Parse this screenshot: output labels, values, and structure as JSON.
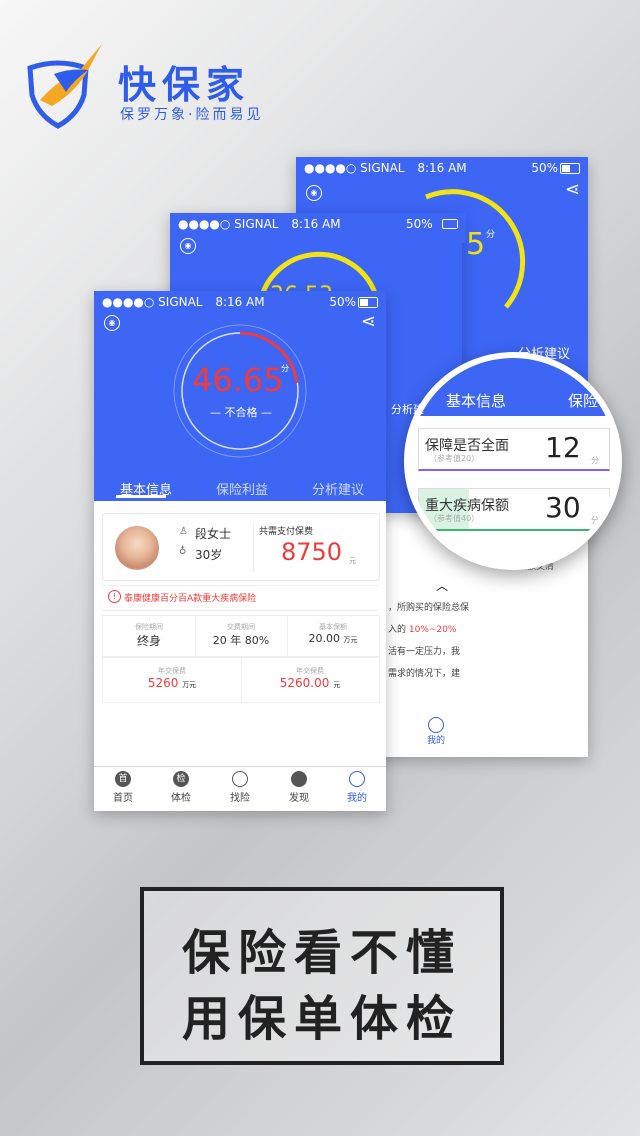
{
  "brand": {
    "name": "快保家",
    "slogan": "保罗万象·险而易见",
    "primary_color": "#2f5dea",
    "header_blue": "#3d66f5",
    "alert_red": "#ef3b3b",
    "logo_icon": "shield-bird-icon"
  },
  "status_bar": {
    "signal": "●●●●○ SIGNAL",
    "time": "8:16 AM",
    "battery": "50%"
  },
  "phone_back": {
    "score_partial": "5",
    "score_unit": "分",
    "tab_label": "分析建议",
    "nav_label": "我的",
    "body_lines": [
      "，所购买的保险总保",
      "入的",
      "10%~20%",
      "活有一定压力，我",
      "需求的情况下，建"
    ],
    "small_label": "减额交清",
    "score_small": "3"
  },
  "phone_mid": {
    "score_partial": "36.53"
  },
  "phone_front": {
    "score": "46.65",
    "score_unit": "分",
    "verdict": "— 不合格 —",
    "tabs": [
      "基本信息",
      "保险利益",
      "分析建议"
    ],
    "person_name": "段女士",
    "person_age": "30岁",
    "total_premium_label": "共需支付保费",
    "total_premium": "8750",
    "total_premium_unit": "元",
    "policy_name": "泰康健康百分百A款重大疾病保险",
    "cells": [
      {
        "label": "保险期间",
        "value": "终身"
      },
      {
        "label": "交费期间",
        "value": "20 年 80%"
      },
      {
        "label": "基本保额",
        "value": "20.00",
        "unit": "万元"
      }
    ],
    "cells2": [
      {
        "label": "年交保费",
        "value": "5260",
        "unit": "万元"
      },
      {
        "label": "年交保费",
        "value": "5260.00",
        "unit": "元"
      }
    ],
    "nav": [
      "首页",
      "体检",
      "找险",
      "发现",
      "我的"
    ],
    "nav_icons": [
      "首",
      "检",
      "",
      "",
      ""
    ]
  },
  "magnifier": {
    "tab_left": "基本信息",
    "tab_right": "保险",
    "row1_label": "保障是否全面",
    "row1_ref": "（参考值20）",
    "row1_value": "12",
    "row1_unit": "分",
    "row2_label": "重大疾病保额",
    "row2_ref": "（参考值40）",
    "row2_value": "30",
    "row2_unit": "分",
    "tab_extra": "分析建议"
  },
  "headline": {
    "line1": "保险看不懂",
    "line2": "用保单体检"
  }
}
